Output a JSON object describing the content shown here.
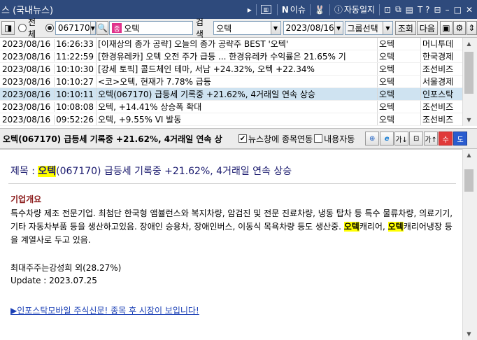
{
  "window": {
    "title": "스 (국내뉴스)",
    "news_issue_label": "이슈",
    "auto_log_label": "자동일지",
    "help_label": "T ?"
  },
  "toolbar": {
    "radio_all_label": "전체",
    "radio_code_label": "",
    "stock_code": "067170",
    "stock_name": "오텍",
    "stock_badge": "종",
    "search_label": "검색",
    "search_field": "오텍",
    "date": "2023/08/16",
    "group_select": "그룹선택",
    "query_button": "조회",
    "next_button": "다음"
  },
  "news": {
    "rows": [
      {
        "date": "2023/08/16",
        "time": "16:26:33",
        "title": "[이재상의 종가 공략] 오늘의 종가 공략주 BEST '오텍'",
        "stock": "오텍",
        "source": "머니투데"
      },
      {
        "date": "2023/08/16",
        "time": "11:22:59",
        "title": "[한경유레카] 오텍 오전 주가 급등 ... 한경유레카 수익률은 21.65% 기",
        "stock": "오텍",
        "source": "한국경제"
      },
      {
        "date": "2023/08/16",
        "time": "10:10:30",
        "title": "[강세 토픽] 콜드체인 테마, 서남 +24.32%, 오텍 +22.34%",
        "stock": "오텍",
        "source": "조선비즈"
      },
      {
        "date": "2023/08/16",
        "time": "10:10:27",
        "title": "<코>오텍, 현재가 7.78% 급등",
        "stock": "오텍",
        "source": "서울경제"
      },
      {
        "date": "2023/08/16",
        "time": "10:10:11",
        "title": "오텍(067170) 급등세 기록중 +21.62%, 4거래일 연속 상승",
        "stock": "오텍",
        "source": "인포스탁",
        "selected": true
      },
      {
        "date": "2023/08/16",
        "time": "10:08:08",
        "title": "오텍, +14.41% 상승폭 확대",
        "stock": "오텍",
        "source": "조선비즈"
      },
      {
        "date": "2023/08/16",
        "time": "09:52:26",
        "title": "오텍, +9.55% VI 발동",
        "stock": "오텍",
        "source": "조선비즈"
      }
    ]
  },
  "detail": {
    "header_title": "오텍(067170) 급등세 기록중 +21.62%, 4거래일 연속 상",
    "link_checkbox_label": "뉴스창에 종목연동",
    "content_checkbox_label": "내용자동",
    "btn_plus": "수",
    "btn_minus": "도"
  },
  "article": {
    "headline_prefix": "제목 : ",
    "headline_hl": "오텍",
    "headline_rest": "(067170) 급등세 기록중 +21.62%, 4거래일 연속 상승",
    "section_title": "기업개요",
    "para_a": "특수차량 제조 전문기업. 최첨단 한국형 앰뷸런스와 복지차량, 암검진 및 전문 진료차량, 냉동 탑차 등 특수 물류차량, 의료기기, 기타 자동차부품 등을 생산하고있음. 장애인 승용차, 장애인버스, 이동식 목욕차량 등도 생산중. ",
    "para_hl1": "오텍",
    "para_b": "캐리어, ",
    "para_hl2": "오텍",
    "para_c": "캐리어냉장 등을 계열사로 두고 있음.",
    "owner": "최대주주는강성희 외(28.27%)",
    "update": "Update : 2023.07.25",
    "promo": "▶인포스탁모바일 주식신문! 종목 후 시장이 보입니다!"
  },
  "colors": {
    "titlebar": "#2e4a7c",
    "selected_row": "#cfe3f1",
    "highlight": "#ffff00",
    "section": "#8b1a1a",
    "link": "#1a3fb5",
    "btn_plus": "#e03a3a",
    "btn_minus": "#2a5ccf"
  }
}
